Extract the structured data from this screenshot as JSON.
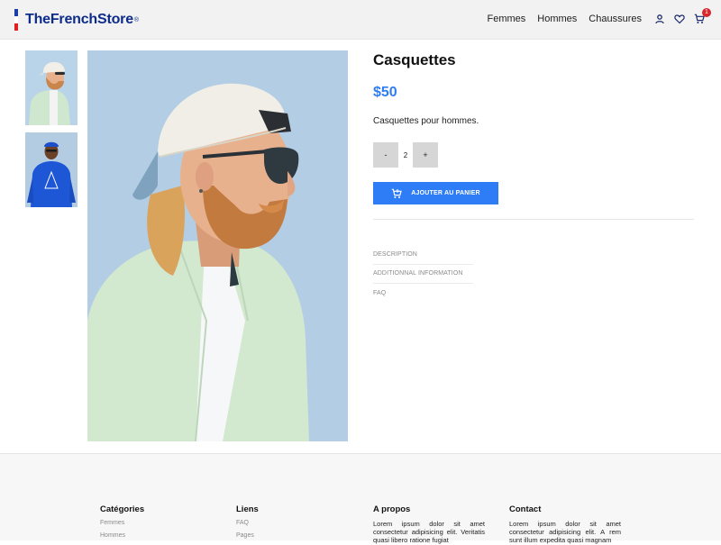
{
  "header": {
    "logo_text": "TheFrenchStore",
    "logo_mark": "®",
    "nav": [
      "Femmes",
      "Hommes",
      "Chaussures"
    ],
    "cart_count": "1",
    "icons": [
      "user-icon",
      "heart-icon",
      "cart-icon"
    ],
    "flag_colors": [
      "#1a3fa8",
      "#ffffff",
      "#e02020"
    ]
  },
  "product": {
    "title": "Casquettes",
    "price": "$50",
    "description": "Casquettes pour hommes.",
    "qty_minus": "-",
    "qty_value": "2",
    "qty_plus": "+",
    "add_to_cart": "AJOUTER AU PANIER",
    "tabs": [
      "DESCRIPTION",
      "ADDITIONNAL INFORMATION",
      "FAQ"
    ],
    "accent_color": "#2f7df6"
  },
  "footer": {
    "col1_title": "Catégories",
    "col1_links": [
      "Femmes",
      "Hommes"
    ],
    "col2_title": "Liens",
    "col2_links": [
      "FAQ",
      "Pages"
    ],
    "col3_title": "A propos",
    "col3_text": "Lorem ipsum dolor sit amet consectetur adipisicing elit. Veritatis quasi libero ratione fugiat",
    "col4_title": "Contact",
    "col4_text": "Lorem ipsum dolor sit amet consectetur adipisicing elit. A rem sunt illum expedita quasi magnam"
  }
}
